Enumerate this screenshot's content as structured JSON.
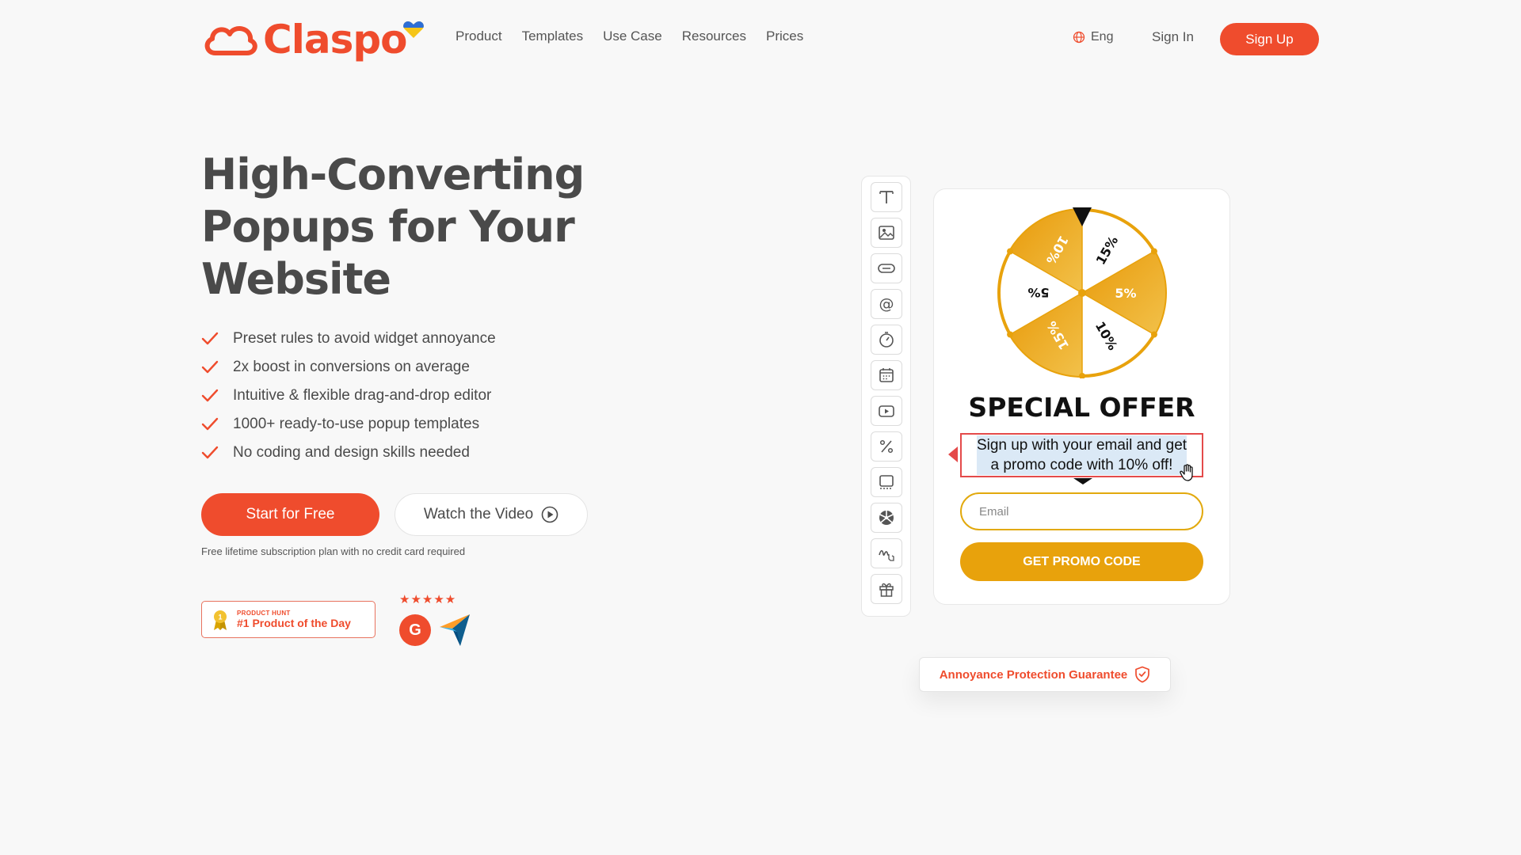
{
  "brand": {
    "name": "Claspo",
    "color": "#ef4c2d"
  },
  "nav": [
    "Product",
    "Templates",
    "Use Case",
    "Resources",
    "Prices"
  ],
  "header": {
    "language": "Eng",
    "sign_in": "Sign In",
    "sign_up": "Sign Up"
  },
  "hero": {
    "title_lines": [
      "High-Converting",
      "Popups for Your",
      "Website"
    ],
    "features": [
      "Preset rules to avoid widget annoyance",
      "2x boost in conversions on average",
      "Intuitive & flexible drag-and-drop editor",
      "1000+ ready-to-use popup templates",
      "No coding and design skills needed"
    ],
    "start_button": "Start for Free",
    "video_button": "Watch the Video",
    "note": "Free lifetime subscription plan with no credit card required"
  },
  "badges": {
    "product_hunt_small": "PRODUCT HUNT",
    "product_hunt_big": "#1 Product of the Day",
    "stars": "★★★★★",
    "g2": "G"
  },
  "toolbar": {
    "tools": [
      "text-tool-icon",
      "image-tool-icon",
      "button-tool-icon",
      "email-tool-icon",
      "timer-tool-icon",
      "calendar-tool-icon",
      "video-tool-icon",
      "discount-tool-icon",
      "container-tool-icon",
      "wheel-tool-icon",
      "signature-tool-icon",
      "gift-tool-icon"
    ]
  },
  "popup": {
    "wheel_labels": [
      "15%",
      "5%",
      "10%",
      "15%",
      "5%",
      "10%"
    ],
    "title": "SPECIAL OFFER",
    "text_line1": "Sign up with your email and get",
    "text_line2": "a promo code with 10% off!",
    "email_placeholder": "Email",
    "button": "GET PROMO CODE",
    "wheel_color": "#e8a20c"
  },
  "guarantee": "Annoyance Protection Guarantee"
}
